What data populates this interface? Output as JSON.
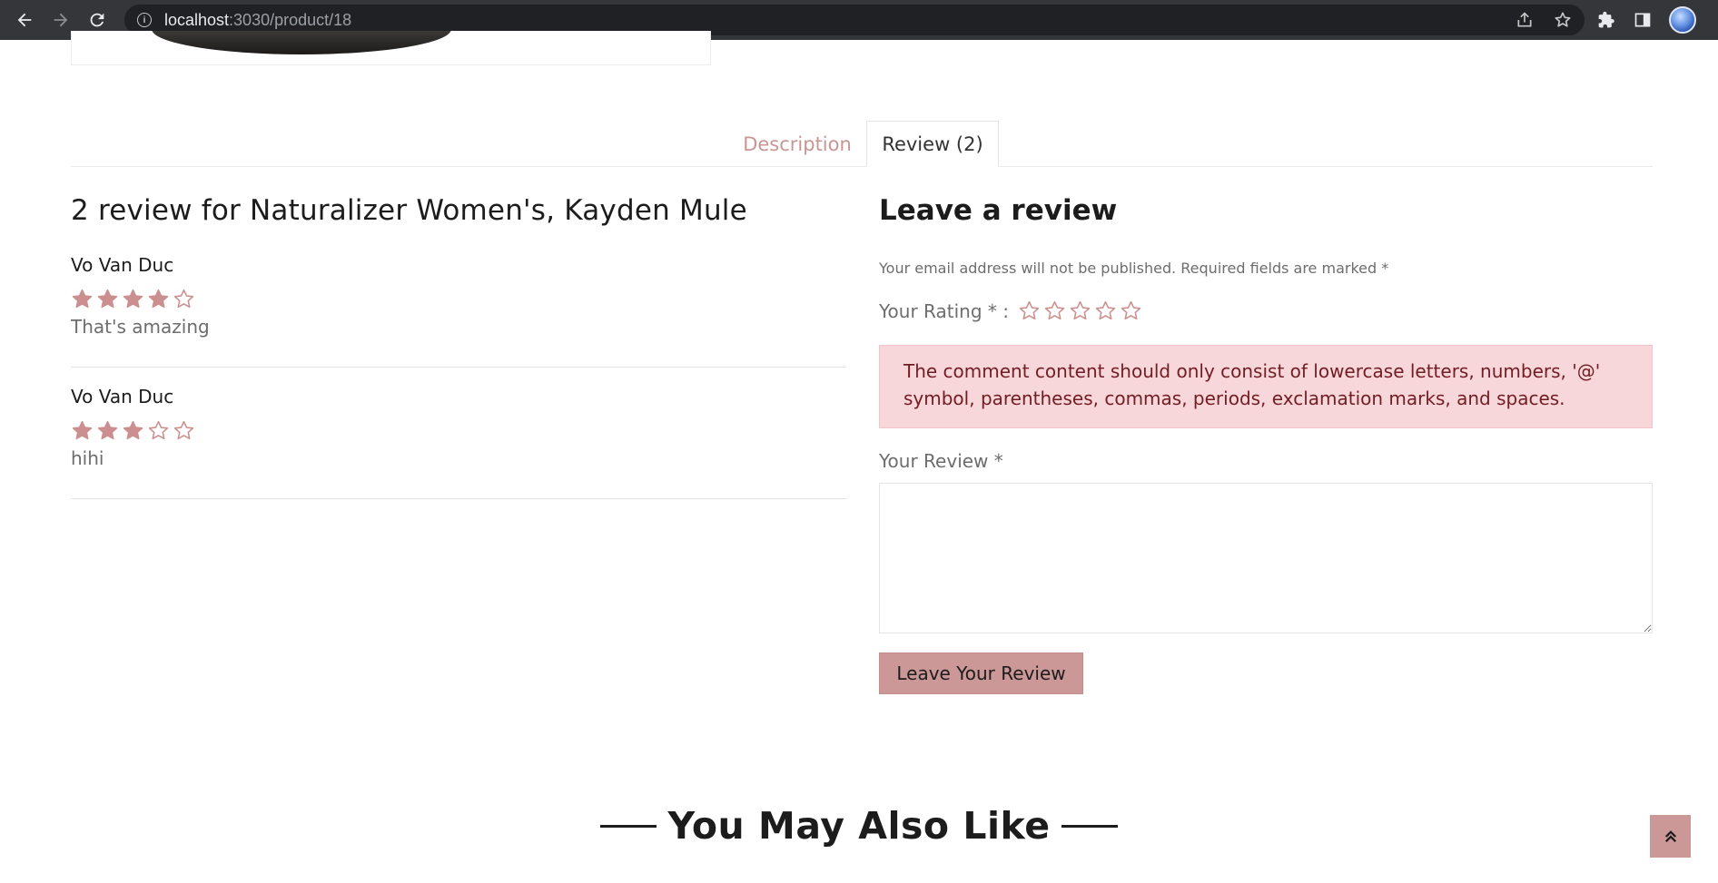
{
  "browser": {
    "url_host": "localhost",
    "url_path": ":3030/product/18"
  },
  "product": {
    "tabs": [
      {
        "label": "Description",
        "active": false
      },
      {
        "label": "Review (2)",
        "active": true
      }
    ]
  },
  "reviews": {
    "heading": "2 review for Naturalizer Women's, Kayden Mule",
    "items": [
      {
        "author": "Vo Van Duc",
        "rating": 4,
        "max_rating": 5,
        "text": "That's amazing"
      },
      {
        "author": "Vo Van Duc",
        "rating": 3,
        "max_rating": 5,
        "text": "hihi"
      }
    ]
  },
  "review_form": {
    "heading": "Leave a review",
    "notice": "Your email address will not be published. Required fields are marked *",
    "rating_label": "Your Rating * :",
    "rating_value": 0,
    "rating_max": 5,
    "error_message": "The comment content should only consist of lowercase letters, numbers, '@' symbol, parentheses, commas, periods, exclamation marks, and spaces.",
    "review_label": "Your Review *",
    "review_value": "",
    "submit_label": "Leave Your Review"
  },
  "related": {
    "heading": "You May Also Like"
  },
  "colors": {
    "accent": "#cc9797",
    "star_filled": "#cc8f8f",
    "alert_bg": "#f8d7da",
    "alert_text": "#721c24"
  },
  "icons": {
    "back": "arrow-left-icon",
    "forward": "arrow-right-icon",
    "reload": "reload-icon",
    "site_info": "info-icon",
    "share": "share-icon",
    "bookmark": "star-outline-icon",
    "extensions": "puzzle-icon",
    "side_panel": "side-panel-icon",
    "scroll_top": "double-chevron-up-icon"
  }
}
